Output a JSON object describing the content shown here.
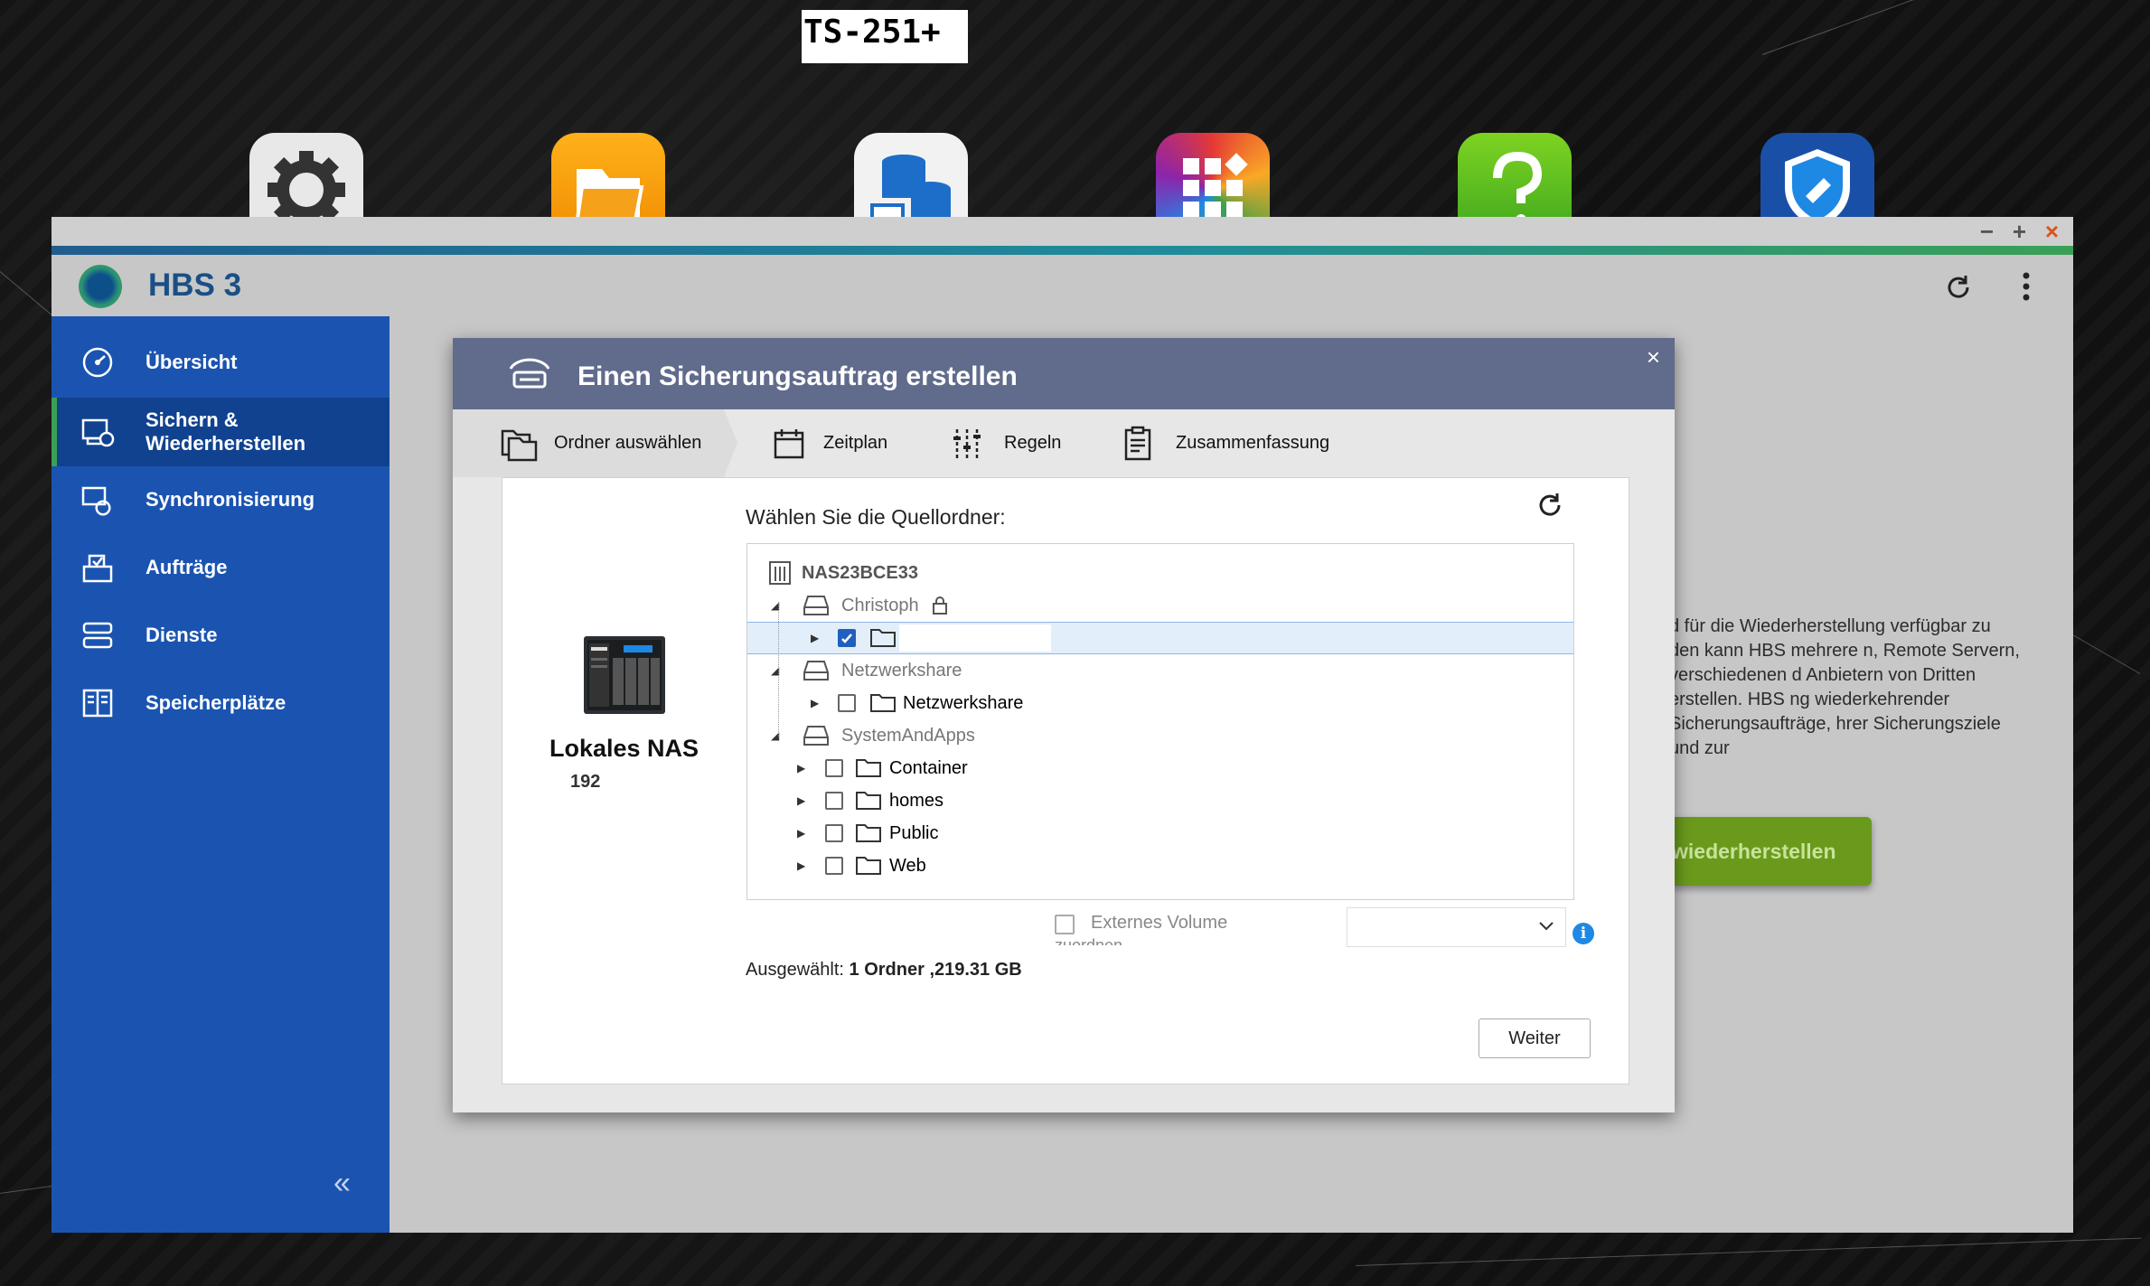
{
  "desktop": {
    "nas_label": "TS-251+",
    "dock_icons": [
      "gear-icon",
      "file-station-icon",
      "backup-storage-icon",
      "app-center-icon",
      "help-icon",
      "security-counselor-icon"
    ]
  },
  "window": {
    "controls": {
      "minimize": "−",
      "maximize": "+",
      "close": "×"
    },
    "app_title": "HBS 3"
  },
  "sidebar": {
    "items": [
      {
        "label": "Übersicht",
        "icon": "dashboard-icon"
      },
      {
        "label": "Sichern &\nWiederherstellen",
        "icon": "backup-restore-icon"
      },
      {
        "label": "Synchronisierung",
        "icon": "sync-icon"
      },
      {
        "label": "Aufträge",
        "icon": "jobs-icon"
      },
      {
        "label": "Dienste",
        "icon": "services-icon"
      },
      {
        "label": "Speicherplätze",
        "icon": "storage-spaces-icon"
      }
    ],
    "collapse": "«"
  },
  "background": {
    "text": "d für die Wiederherstellung verfügbar zu den kann HBS mehrere n, Remote Servern, verschiedenen d Anbietern von Dritten erstellen. HBS ng wiederkehrender Sicherungsaufträge, hrer Sicherungsziele und zur",
    "restore_button": "wiederherstellen"
  },
  "modal": {
    "title": "Einen Sicherungsauftrag erstellen",
    "close": "×",
    "steps": [
      {
        "label": "Ordner auswählen",
        "icon": "folder-select-icon"
      },
      {
        "label": "Zeitplan",
        "icon": "calendar-icon"
      },
      {
        "label": "Regeln",
        "icon": "sliders-icon"
      },
      {
        "label": "Zusammenfassung",
        "icon": "summary-icon"
      }
    ],
    "nas": {
      "name": "Lokales NAS",
      "ip": "192"
    },
    "source_label": "Wählen Sie die Quellordner:",
    "tree": {
      "root": "NAS23BCE33",
      "shares": [
        {
          "name": "Christoph",
          "locked": true,
          "children": [
            {
              "name": "",
              "checked": true
            }
          ]
        },
        {
          "name": "Netzwerkshare",
          "children": [
            {
              "name": "Netzwerkshare",
              "checked": false
            }
          ]
        },
        {
          "name": "SystemAndApps",
          "children": [
            {
              "name": "Container",
              "checked": false
            },
            {
              "name": "homes",
              "checked": false
            },
            {
              "name": "Public",
              "checked": false
            },
            {
              "name": "Web",
              "checked": false
            }
          ]
        }
      ]
    },
    "external_volume": {
      "label": "Externes Volume",
      "sub": "zuordnen"
    },
    "selected": {
      "prefix": "Ausgewählt:",
      "value": "1 Ordner ,219.31 GB"
    },
    "next_button": "Weiter"
  }
}
